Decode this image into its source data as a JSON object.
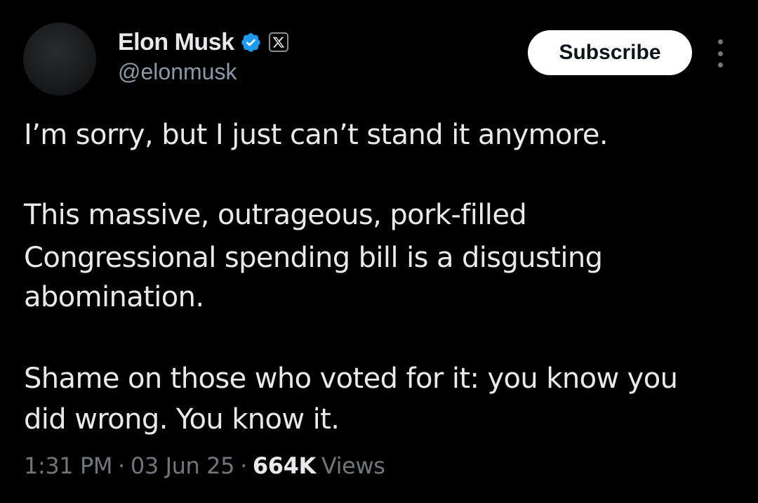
{
  "author": {
    "name": "Elon Musk",
    "handle": "@elonmusk",
    "verified_color": "#1d9bf0"
  },
  "actions": {
    "subscribe_label": "Subscribe",
    "more_icon": "more-options-icon"
  },
  "tweet": {
    "lines": [
      "I’m sorry, but I just can’t stand it anymore.",
      "This massive, outrageous, pork-filled",
      "Congressional spending bill is a disgusting",
      "abomination.",
      "Shame on those who voted for it: you know you",
      "did wrong. You know it."
    ]
  },
  "meta": {
    "time": "1:31 PM",
    "separator": "·",
    "date": "03 Jun 25",
    "views_count": "664K",
    "views_label": "Views"
  },
  "colors": {
    "background": "#000000",
    "primary_text": "#e7e9ea",
    "secondary_text": "#71767b",
    "button_bg": "#ffffff"
  }
}
